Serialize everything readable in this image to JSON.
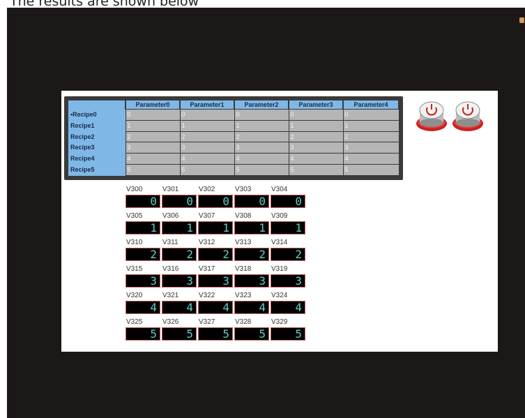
{
  "caption": "The results are shown below",
  "colors": {
    "bezel": "#1c1818",
    "header_bg": "#7fb8e6",
    "cell_bg": "#b5b5b5",
    "display_bg": "#000000",
    "display_border": "#c0605e",
    "display_digit": "#5fd0c6",
    "button_ring": "#cc1f1f"
  },
  "recipe_table": {
    "columns": [
      "Parameter0",
      "Parameter1",
      "Parameter2",
      "Parameter3",
      "Parameter4"
    ],
    "rows": [
      {
        "name": "•Recipe0",
        "values": [
          "0",
          "0",
          "0",
          "0",
          "0"
        ]
      },
      {
        "name": "Recipe1",
        "values": [
          "1",
          "1",
          "1",
          "1",
          "1"
        ]
      },
      {
        "name": "Recipe2",
        "values": [
          "2",
          "2",
          "2",
          "2",
          "2"
        ]
      },
      {
        "name": "Recipe3",
        "values": [
          "3",
          "3",
          "3",
          "3",
          "3"
        ]
      },
      {
        "name": "Recipe4",
        "values": [
          "4",
          "4",
          "4",
          "4",
          "4"
        ]
      },
      {
        "name": "Recipe5",
        "values": [
          "5",
          "5",
          "5",
          "5",
          "5"
        ]
      }
    ]
  },
  "buttons": [
    {
      "icon": "power-icon"
    },
    {
      "icon": "power-icon"
    }
  ],
  "displays": [
    [
      {
        "label": "V300",
        "value": "0"
      },
      {
        "label": "V301",
        "value": "0"
      },
      {
        "label": "V302",
        "value": "0"
      },
      {
        "label": "V303",
        "value": "0"
      },
      {
        "label": "V304",
        "value": "0"
      }
    ],
    [
      {
        "label": "V305",
        "value": "1"
      },
      {
        "label": "V306",
        "value": "1"
      },
      {
        "label": "V307",
        "value": "1"
      },
      {
        "label": "V308",
        "value": "1"
      },
      {
        "label": "V309",
        "value": "1"
      }
    ],
    [
      {
        "label": "V310",
        "value": "2"
      },
      {
        "label": "V311",
        "value": "2"
      },
      {
        "label": "V312",
        "value": "2"
      },
      {
        "label": "V313",
        "value": "2"
      },
      {
        "label": "V314",
        "value": "2"
      }
    ],
    [
      {
        "label": "V315",
        "value": "3"
      },
      {
        "label": "V316",
        "value": "3"
      },
      {
        "label": "V317",
        "value": "3"
      },
      {
        "label": "V318",
        "value": "3"
      },
      {
        "label": "V319",
        "value": "3"
      }
    ],
    [
      {
        "label": "V320",
        "value": "4"
      },
      {
        "label": "V321",
        "value": "4"
      },
      {
        "label": "V322",
        "value": "4"
      },
      {
        "label": "V323",
        "value": "4"
      },
      {
        "label": "V324",
        "value": "4"
      }
    ],
    [
      {
        "label": "V325",
        "value": "5"
      },
      {
        "label": "V326",
        "value": "5"
      },
      {
        "label": "V327",
        "value": "5"
      },
      {
        "label": "V328",
        "value": "5"
      },
      {
        "label": "V329",
        "value": "5"
      }
    ]
  ]
}
